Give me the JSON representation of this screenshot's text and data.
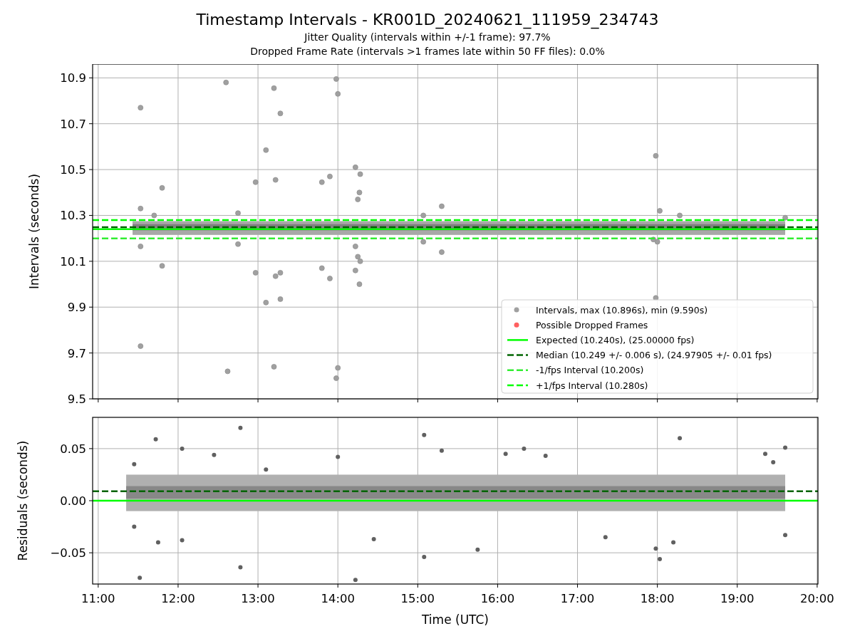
{
  "title": "Timestamp Intervals - KR001D_20240621_111959_234743",
  "subtitles": [
    "Jitter Quality (intervals within +/-1 frame): 97.7%",
    "Dropped Frame Rate (intervals >1 frames late within 50 FF files): 0.0%"
  ],
  "charts": [
    {
      "chart_data": {
        "type": "scatter",
        "ylabel": "Intervals (seconds)",
        "xlim": [
          10.93,
          20.01
        ],
        "ylim": [
          9.5,
          10.96
        ],
        "yticks": [
          {
            "value": 9.5,
            "label": "9.5"
          },
          {
            "value": 9.7,
            "label": "9.7"
          },
          {
            "value": 9.9,
            "label": "9.9"
          },
          {
            "value": 10.1,
            "label": "10.1"
          },
          {
            "value": 10.3,
            "label": "10.3"
          },
          {
            "value": 10.5,
            "label": "10.5"
          },
          {
            "value": 10.7,
            "label": "10.7"
          },
          {
            "value": 10.9,
            "label": "10.9"
          }
        ],
        "legend": true,
        "series": [
          {
            "name": "Intervals, max (10.896s), min (9.590s)",
            "color": "#a0a0a0",
            "x": [
              11.53,
              11.53,
              11.53,
              11.53,
              11.8,
              11.8,
              11.7,
              12.6,
              12.62,
              12.75,
              12.75,
              12.97,
              12.97,
              13.1,
              13.1,
              13.2,
              13.22,
              13.22,
              13.2,
              13.28,
              13.28,
              13.28,
              13.8,
              13.8,
              13.9,
              13.9,
              13.98,
              14.0,
              14.0,
              13.98,
              14.22,
              14.28,
              14.27,
              14.25,
              14.22,
              14.25,
              14.28,
              14.22,
              14.27,
              15.07,
              15.07,
              15.3,
              15.3,
              17.98,
              18.03,
              17.98,
              18.0,
              17.95,
              18.28,
              19.6
            ],
            "values": [
              10.77,
              10.33,
              10.165,
              9.73,
              10.42,
              10.08,
              10.3,
              10.88,
              9.62,
              10.31,
              10.175,
              10.445,
              10.05,
              10.585,
              9.92,
              10.855,
              10.455,
              10.035,
              9.64,
              10.745,
              10.05,
              9.935,
              10.445,
              10.07,
              10.47,
              10.025,
              10.895,
              10.83,
              9.635,
              9.59,
              10.51,
              10.48,
              10.4,
              10.37,
              10.165,
              10.12,
              10.1,
              10.06,
              10.0,
              10.3,
              10.185,
              10.34,
              10.14,
              10.56,
              10.32,
              9.94,
              10.185,
              10.195,
              10.3,
              10.29
            ]
          },
          {
            "name": "Possible Dropped Frames",
            "color": "#ff6060"
          }
        ],
        "ref_lines": [
          {
            "axis": "y",
            "value": 10.24,
            "label": "Expected (10.240s), (25.00000 fps)",
            "color": "#00ff00"
          },
          {
            "axis": "y",
            "value": 10.249,
            "label": "Median (10.249 +/- 0.006 s), (24.97905 +/- 0.01 fps)",
            "color": "#006400"
          },
          {
            "axis": "y",
            "value": 10.2,
            "label": "-1/fps Interval (10.200s)",
            "color": "#32ee32"
          },
          {
            "axis": "y",
            "value": 10.28,
            "label": "+1/fps Interval (10.280s)",
            "color": "#00ff00"
          }
        ],
        "bands": [
          {
            "axis": "y",
            "from": 10.215,
            "to": 10.275,
            "color": "#a8a8a8"
          },
          {
            "axis": "y",
            "from": 10.235,
            "to": 10.262,
            "color": "#808080"
          }
        ],
        "grid": true
      }
    },
    {
      "chart_data": {
        "type": "scatter",
        "xlabel": "Time (UTC)",
        "ylabel": "Residuals (seconds)",
        "xlim": [
          10.93,
          20.01
        ],
        "ylim": [
          -0.08,
          0.08
        ],
        "xticks": [
          {
            "value": 11,
            "label": "11:00"
          },
          {
            "value": 12,
            "label": "12:00"
          },
          {
            "value": 13,
            "label": "13:00"
          },
          {
            "value": 14,
            "label": "14:00"
          },
          {
            "value": 15,
            "label": "15:00"
          },
          {
            "value": 16,
            "label": "16:00"
          },
          {
            "value": 17,
            "label": "17:00"
          },
          {
            "value": 18,
            "label": "18:00"
          },
          {
            "value": 19,
            "label": "19:00"
          },
          {
            "value": 20,
            "label": "20:00"
          }
        ],
        "yticks": [
          {
            "value": -0.05,
            "label": "−0.05"
          },
          {
            "value": 0,
            "label": "0.00"
          },
          {
            "value": 0.05,
            "label": "0.05"
          }
        ],
        "legend": false,
        "series": [
          {
            "color": "#606060",
            "x": [
              11.52,
              11.72,
              11.75,
              12.05,
              12.05,
              12.78,
              12.78,
              14.0,
              14.22,
              14.45,
              15.08,
              15.08,
              15.3,
              15.75,
              16.33,
              17.35,
              17.98,
              18.03,
              18.28,
              19.6,
              19.6,
              16.6,
              18.2,
              11.45,
              11.45,
              12.45,
              13.1,
              16.1,
              19.35,
              19.45
            ],
            "values": [
              -0.074,
              0.059,
              -0.04,
              0.05,
              -0.038,
              0.07,
              -0.064,
              0.042,
              -0.076,
              -0.037,
              0.063,
              -0.054,
              0.048,
              -0.047,
              0.05,
              -0.035,
              -0.046,
              -0.056,
              0.06,
              0.051,
              -0.033,
              0.043,
              -0.04,
              0.035,
              -0.025,
              0.044,
              0.03,
              0.045,
              0.045,
              0.037
            ]
          }
        ],
        "ref_lines": [
          {
            "axis": "y",
            "value": 0.009,
            "color": "#006400"
          },
          {
            "axis": "y",
            "value": 0,
            "color": "#00ff00"
          }
        ],
        "bands": [
          {
            "axis": "y",
            "from": -0.01,
            "to": 0.025,
            "color": "#b0b0b0"
          },
          {
            "axis": "y",
            "from": 0.002,
            "to": 0.014,
            "color": "#888888"
          }
        ],
        "grid": true
      }
    }
  ]
}
